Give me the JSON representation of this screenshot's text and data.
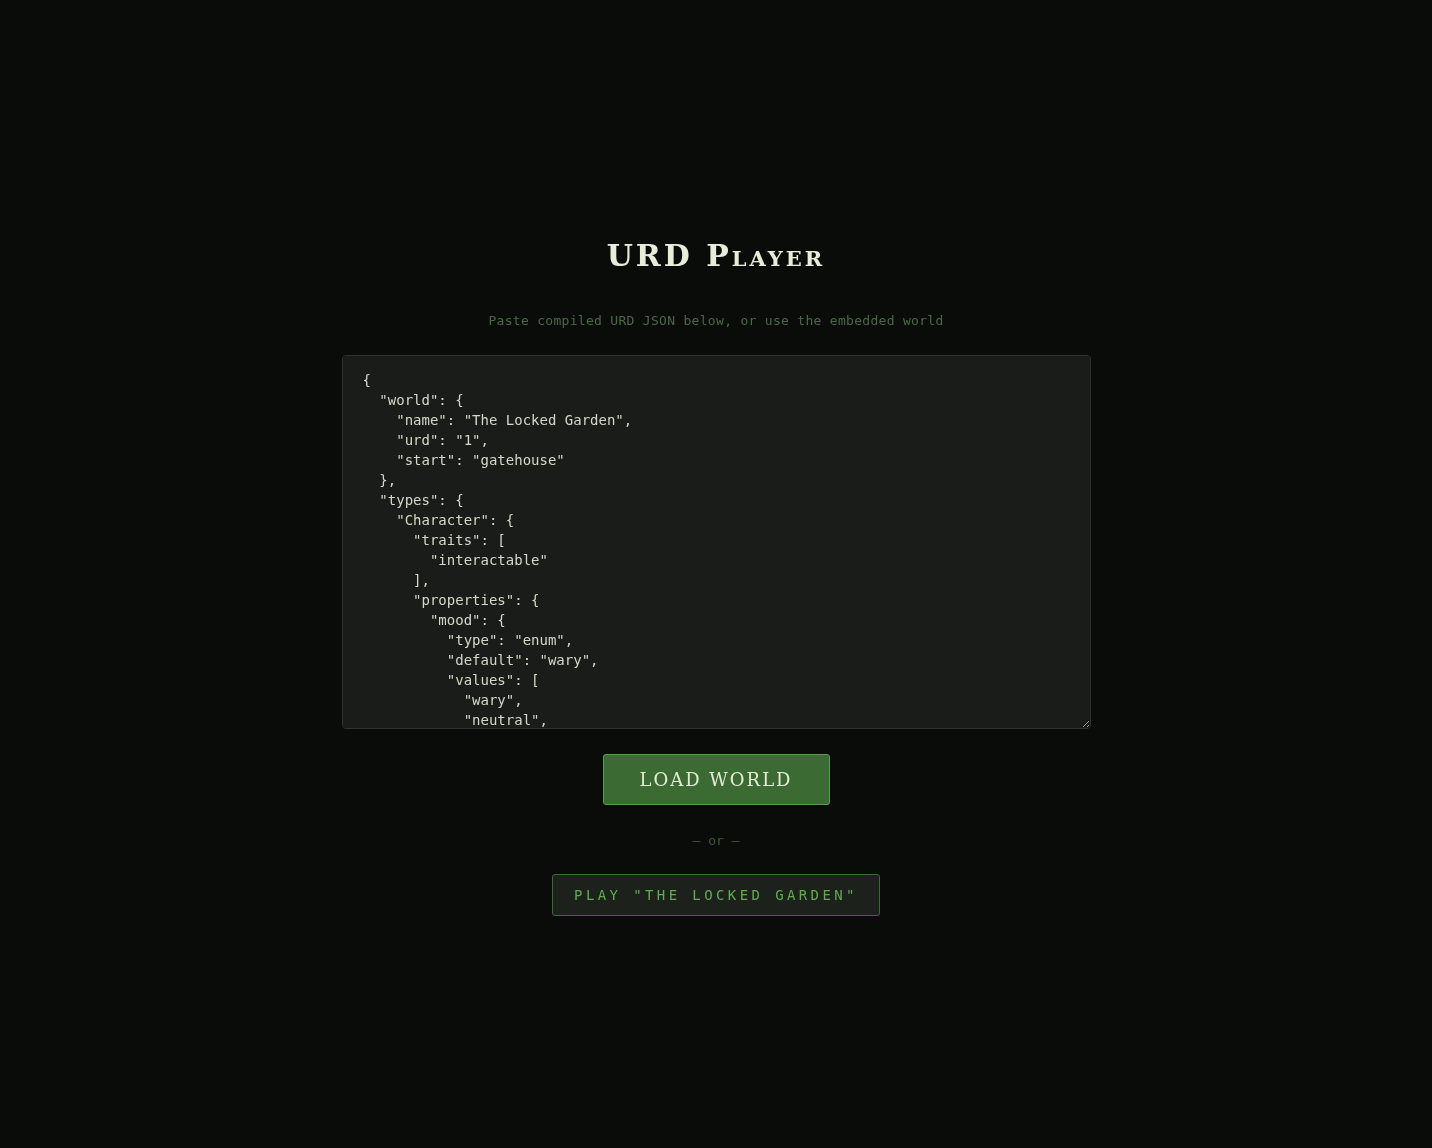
{
  "title": "URD Player",
  "subtitle": "Paste compiled URD JSON below, or use the embedded world",
  "editor": {
    "value": "{\n  \"world\": {\n    \"name\": \"The Locked Garden\",\n    \"urd\": \"1\",\n    \"start\": \"gatehouse\"\n  },\n  \"types\": {\n    \"Character\": {\n      \"traits\": [\n        \"interactable\"\n      ],\n      \"properties\": {\n        \"mood\": {\n          \"type\": \"enum\",\n          \"default\": \"wary\",\n          \"values\": [\n            \"wary\",\n            \"neutral\","
  },
  "load_button": "LOAD WORLD",
  "separator": "— or —",
  "play_button": "PLAY \"THE LOCKED GARDEN\""
}
